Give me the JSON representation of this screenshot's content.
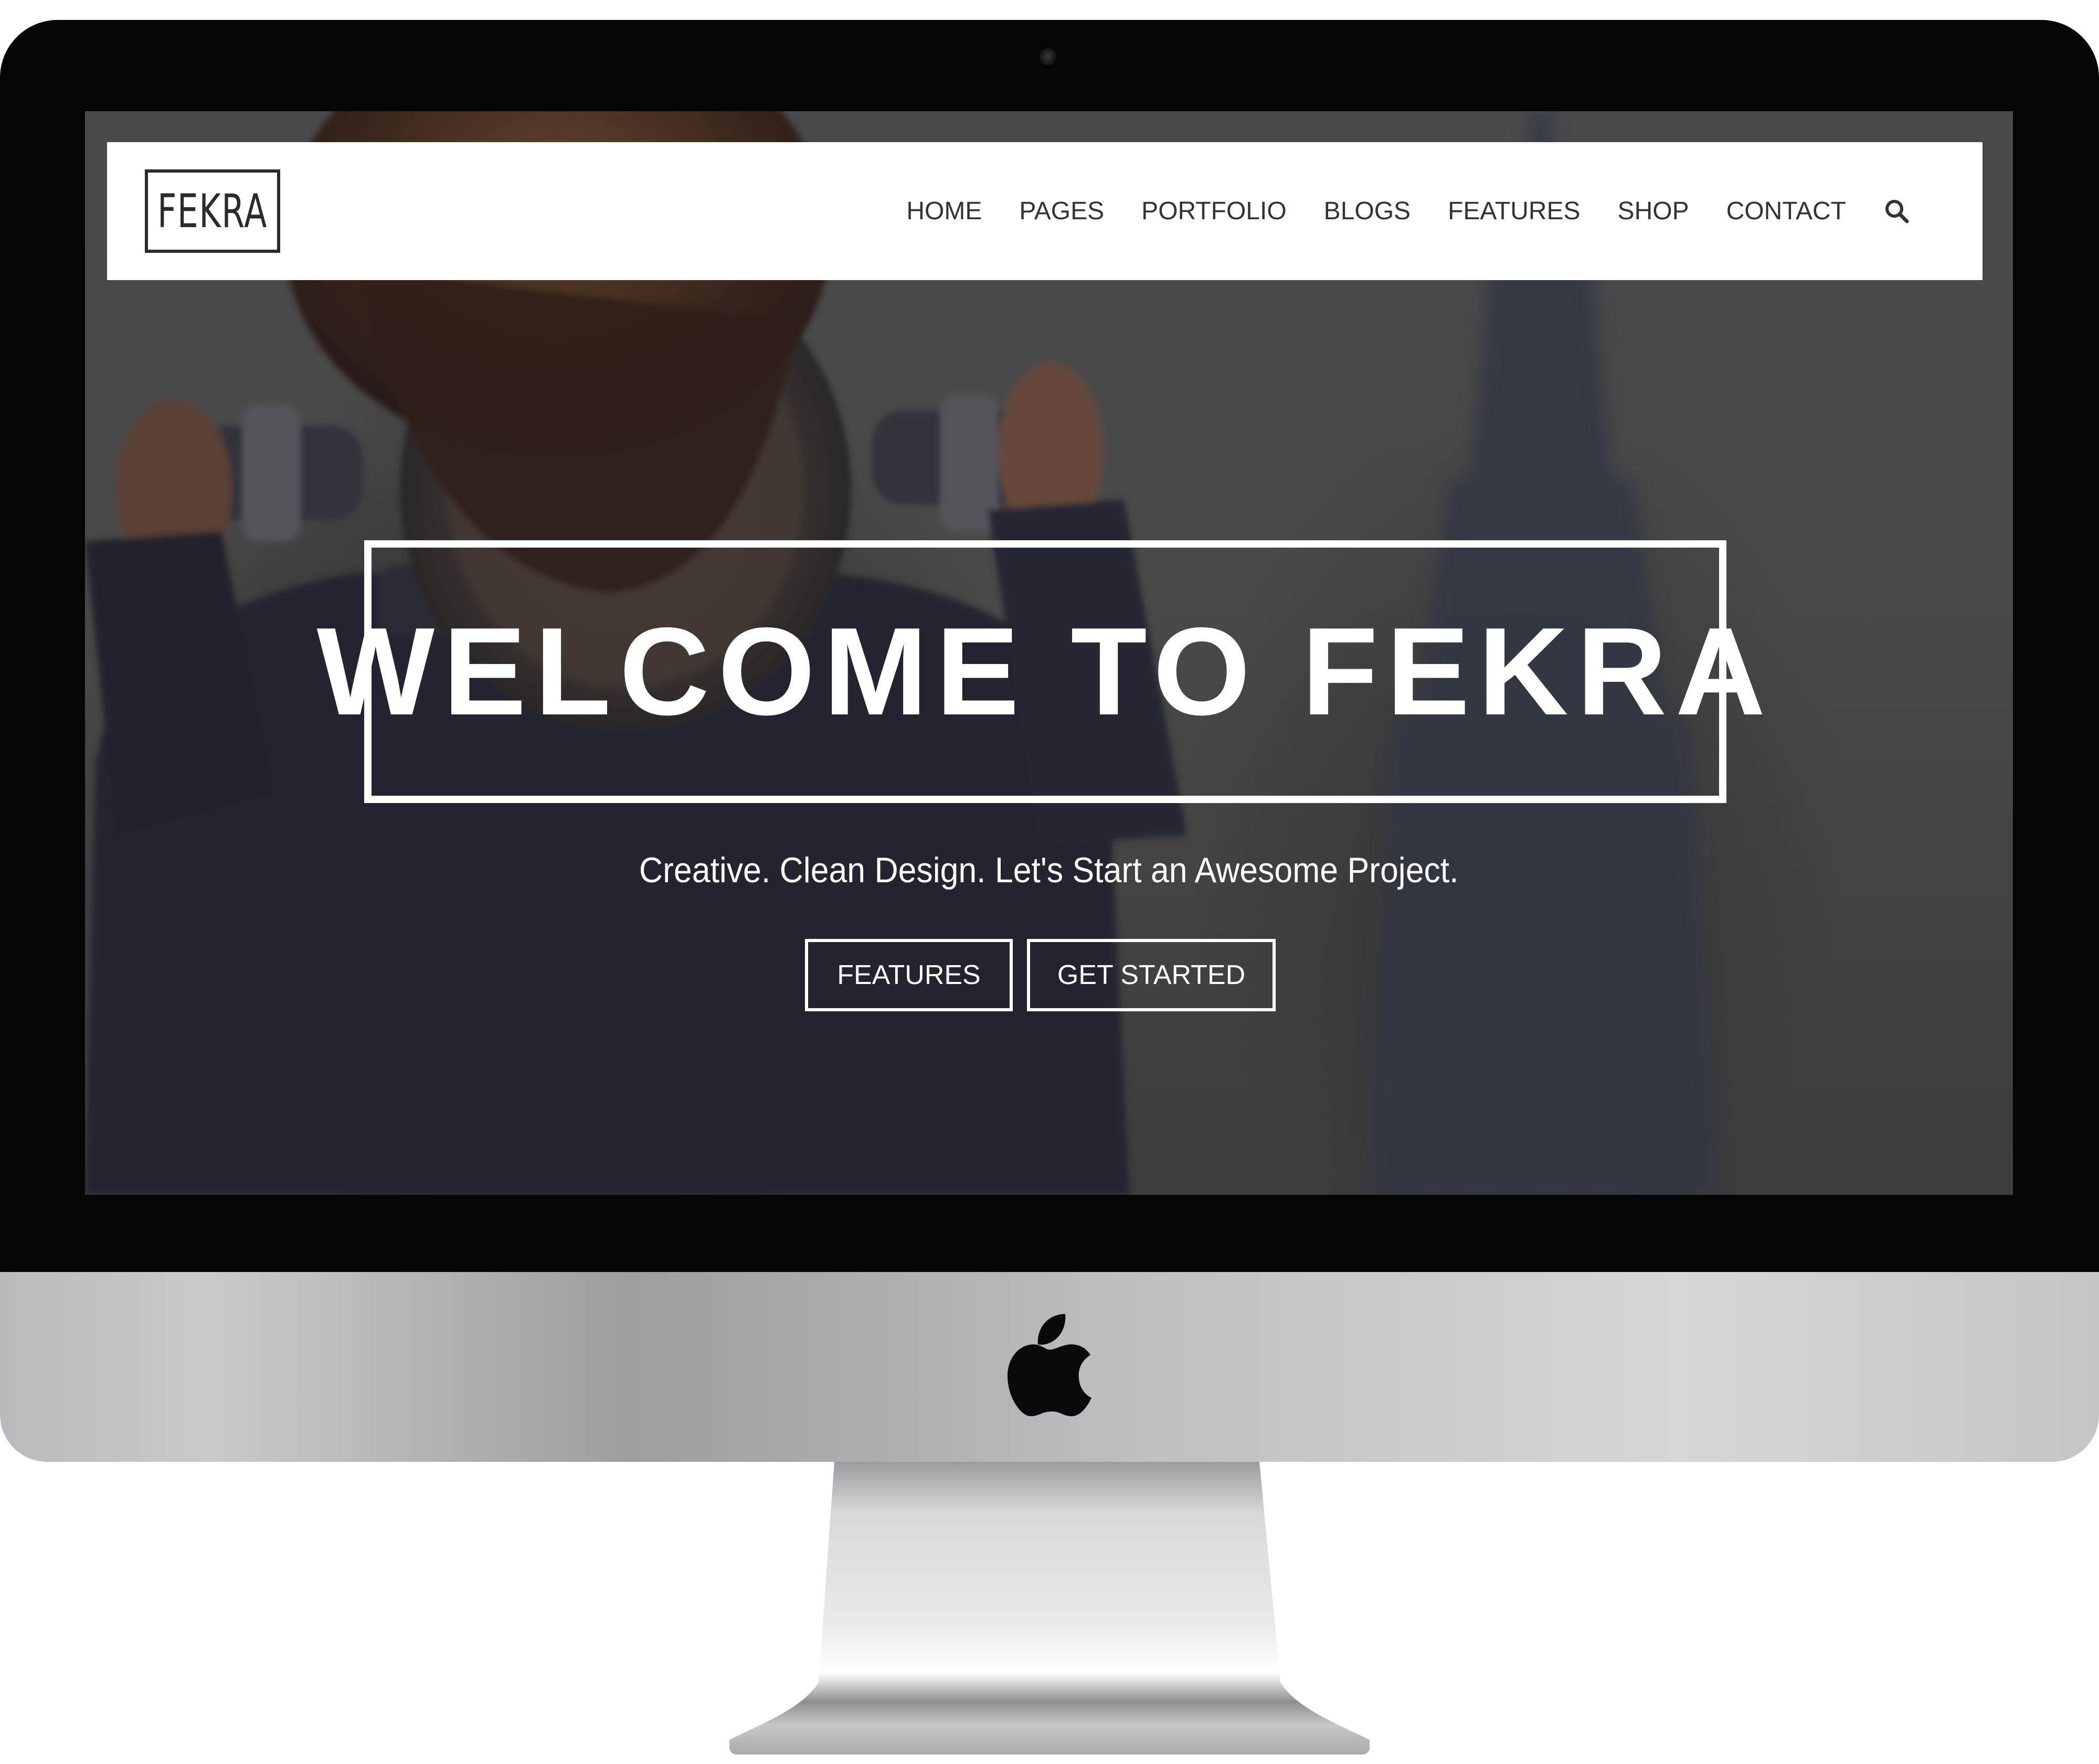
{
  "brand": {
    "logo_text": "FEKRA"
  },
  "nav": {
    "items": [
      {
        "label": "HOME"
      },
      {
        "label": "PAGES"
      },
      {
        "label": "PORTFOLIO"
      },
      {
        "label": "BLOGS"
      },
      {
        "label": "FEATURES"
      },
      {
        "label": "SHOP"
      },
      {
        "label": "CONTACT"
      }
    ],
    "search_icon": "search-icon"
  },
  "hero": {
    "title": "WELCOME TO FEKRA",
    "subtitle": "Creative. Clean Design. Let's Start an Awesome Project.",
    "buttons": {
      "features": "FEATURES",
      "get_started": "GET STARTED"
    }
  },
  "device": {
    "hardware_logo": "apple-logo"
  },
  "colors": {
    "bezel": "#050505",
    "navbar_bg": "#ffffff",
    "nav_text": "#333333",
    "hero_text": "#ffffff",
    "chin": "#c4c5c8"
  }
}
